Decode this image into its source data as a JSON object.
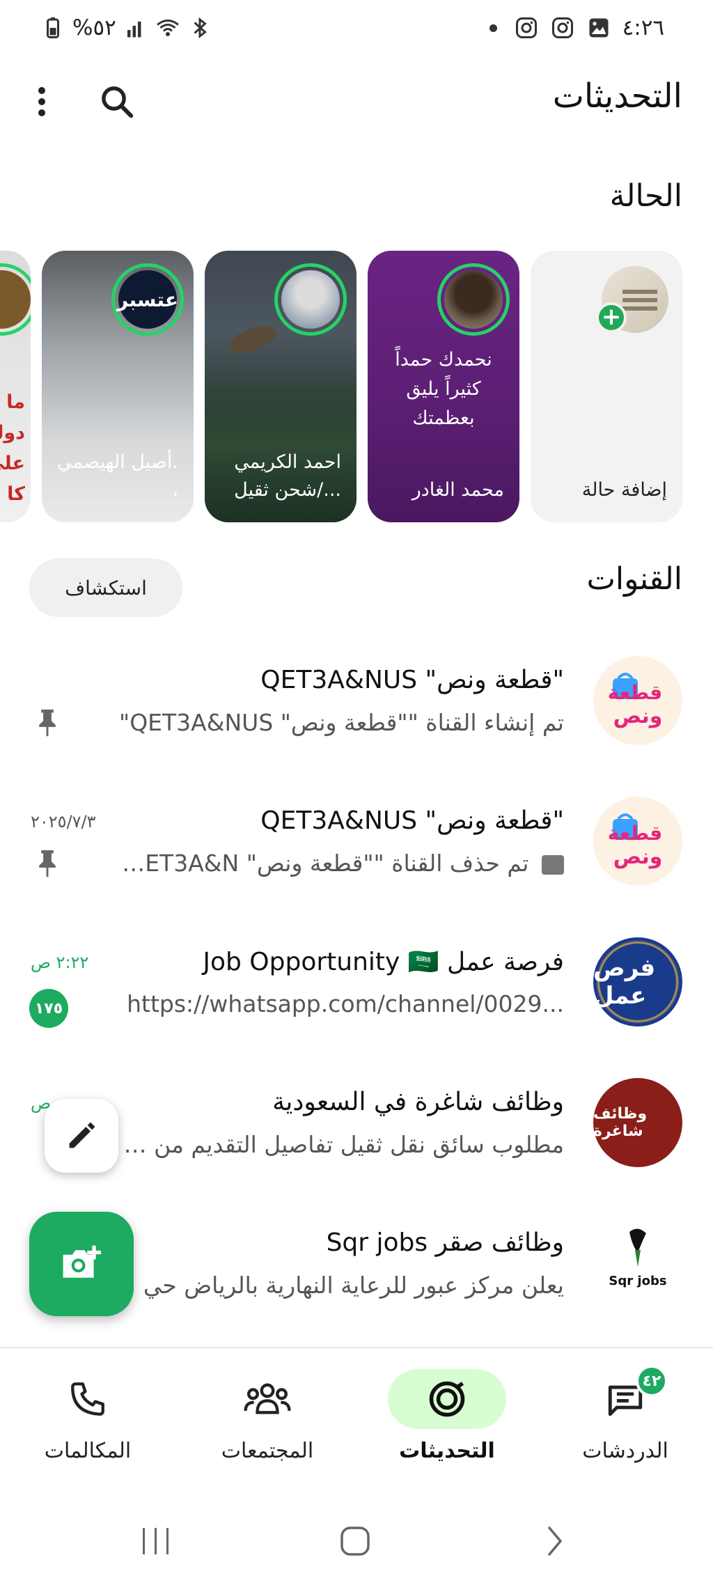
{
  "status_bar": {
    "time": "٤:٢٦",
    "battery": "%٥٢"
  },
  "header": {
    "title": "التحديثات"
  },
  "status_section": {
    "title": "الحالة",
    "cards": [
      {
        "name": "إضافة حالة"
      },
      {
        "name": "محمد الغادر",
        "message": "نحمدك حمداً كثيراً يليق بعظمتك"
      },
      {
        "name": "احمد الكريمي شحن ثقيل/..."
      },
      {
        "name": "أصيل الهيصمي. ،",
        "avatar_text": "عتسبر"
      },
      {
        "partial_text": "ما\nدولة\nعلي\nكا"
      }
    ]
  },
  "channels_section": {
    "title": "القنوات",
    "explore_label": "استكشاف",
    "channels": [
      {
        "name": "\"قطعة ونص\" QET3A&NUS",
        "preview": "تم إنشاء القناة \"\"قطعة ونص\" QET3A&NUS\"",
        "time": "",
        "pinned": true,
        "avatar_text": "قطعة ونص"
      },
      {
        "name": "\"قطعة ونص\" QET3A&NUS",
        "preview": "تم حذف القناة \"\"قطعة ونص\" QET3A&N...",
        "time": "٢٠٢٥/٧/٣",
        "pinned": true,
        "avatar_text": "قطعة ونص"
      },
      {
        "name": "فرصة عمل Job Opportunity 🇸🇦",
        "preview": "https://whatsapp.com/channel/0029...",
        "time": "٢:٢٢ ص",
        "unread": "١٧٥",
        "avatar_text": "فرص عمل"
      },
      {
        "name": "وظائف شاغرة في السعودية",
        "preview": "مطلوب سائق نقل ثقيل تفاصيل التقديم من خ...",
        "time": "ص",
        "avatar_text": "وظائف شاغرة"
      },
      {
        "name": "وظائف صقر Sqr jobs",
        "preview": "يعلن مركز عبور للرعاية النهارية بالرياض حي",
        "avatar_text": "Sqr jobs"
      }
    ]
  },
  "bottom_nav": {
    "items": [
      {
        "label": "المكالمات"
      },
      {
        "label": "المجتمعات"
      },
      {
        "label": "التحديثات"
      },
      {
        "label": "الدردشات",
        "badge": "٤٢"
      }
    ]
  },
  "colors": {
    "accent": "#1daa61",
    "active_nav_bg": "#d8fdd2",
    "ring": "#25d366"
  }
}
